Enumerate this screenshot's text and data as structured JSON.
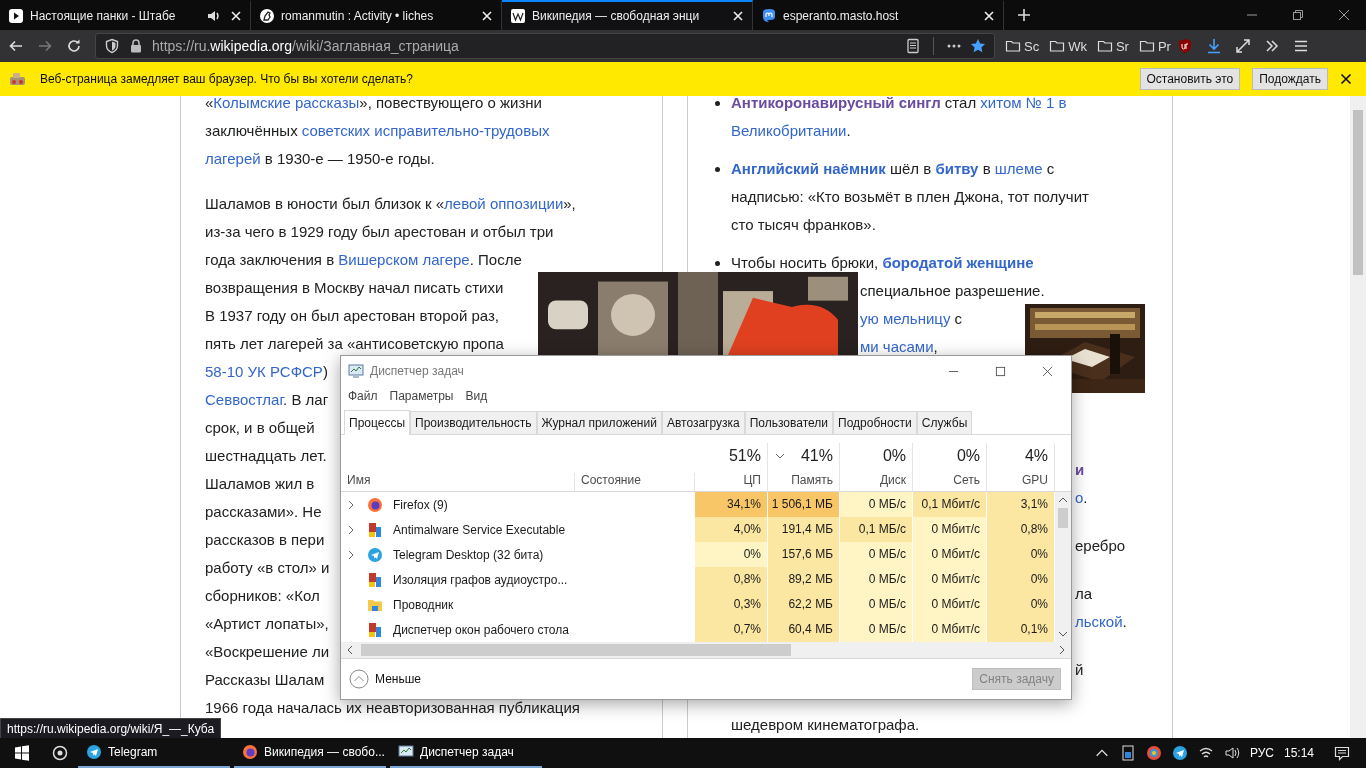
{
  "browser": {
    "tabs": [
      {
        "title": "Настоящие панки - Штабе",
        "kind": "video",
        "audio": true,
        "selected": false
      },
      {
        "title": "romanmutin : Activity • liches",
        "kind": "chess",
        "audio": false,
        "selected": false
      },
      {
        "title": "Википедия — свободная энци",
        "kind": "wiki",
        "audio": false,
        "selected": true
      },
      {
        "title": "esperanto.masto.host",
        "kind": "mastodon",
        "audio": false,
        "selected": false
      }
    ],
    "url": {
      "scheme": "https://ru.",
      "domain": "wikipedia.org",
      "path": "/wiki/Заглавная_страница"
    },
    "bookmarks": [
      "Sc",
      "Wk",
      "Sr",
      "Pr"
    ],
    "notification": {
      "text": "Веб-страница замедляет ваш браузер. Что бы вы хотели сделать?",
      "buttons": [
        "Остановить это",
        "Подождать"
      ]
    }
  },
  "article": {
    "left_paragraphs": [
      [
        [
          {
            "text": "«",
            "kind": "plain"
          },
          {
            "text": "Колымские рассказы",
            "kind": "link"
          },
          {
            "text": "», повествующего о жизни",
            "kind": "plain"
          }
        ],
        [
          {
            "text": "заключённых ",
            "kind": "plain"
          },
          {
            "text": "советских исправительно-трудовых",
            "kind": "link"
          }
        ],
        [
          {
            "text": "лагерей",
            "kind": "link"
          },
          {
            "text": " в 1930-е — 1950-е годы.",
            "kind": "plain"
          }
        ]
      ],
      [
        [
          {
            "text": "Шаламов в юности был близок к «",
            "kind": "plain"
          },
          {
            "text": "левой оппозиции",
            "kind": "link"
          },
          {
            "text": "»,",
            "kind": "plain"
          }
        ],
        [
          {
            "text": "из-за чего в 1929 году был арестован и отбыл три",
            "kind": "plain"
          }
        ],
        [
          {
            "text": "года заключения в ",
            "kind": "plain"
          },
          {
            "text": "Вишерском лагере",
            "kind": "link"
          },
          {
            "text": ". После",
            "kind": "plain"
          }
        ],
        [
          {
            "text": "возвращения в Москву начал писать стихи",
            "kind": "plain"
          }
        ],
        [
          {
            "text": "В 1937 году он был арестован второй раз,",
            "kind": "plain"
          }
        ],
        [
          {
            "text": "пять лет лагерей за «антисоветскую пропа",
            "kind": "plain"
          }
        ],
        [
          {
            "text": "58-10 УК РСФСР",
            "kind": "link"
          },
          {
            "text": ")",
            "kind": "plain"
          }
        ],
        [
          {
            "text": "Севвостлаг",
            "kind": "link"
          },
          {
            "text": ". В лаг",
            "kind": "plain"
          }
        ],
        [
          {
            "text": "срок, и в общей",
            "kind": "plain"
          }
        ],
        [
          {
            "text": "шестнадцать лет.",
            "kind": "plain"
          }
        ],
        [
          {
            "text": "Шаламов жил в",
            "kind": "plain"
          }
        ],
        [
          {
            "text": "рассказами». Не",
            "kind": "plain"
          }
        ],
        [
          {
            "text": "рассказов в пери",
            "kind": "plain"
          }
        ],
        [
          {
            "text": "работу «в стол» и",
            "kind": "plain"
          }
        ],
        [
          {
            "text": "сборников: «Кол",
            "kind": "plain"
          }
        ],
        [
          {
            "text": "«Артист лопаты»,",
            "kind": "plain"
          }
        ],
        [
          {
            "text": "«Воскрешение ли",
            "kind": "plain"
          }
        ],
        [
          {
            "text": "Рассказы Шалам",
            "kind": "plain"
          }
        ],
        [
          {
            "text": "1966 года началась их неавторизованная публикация",
            "kind": "plain"
          }
        ]
      ]
    ],
    "right_items": [
      {
        "lines": [
          [
            {
              "text": "Антикоронавирусный сингл",
              "kind": "visited-bold"
            },
            {
              "text": " стал ",
              "kind": "plain"
            },
            {
              "text": "хитом № 1 в",
              "kind": "link"
            }
          ],
          [
            {
              "text": "Великобритании",
              "kind": "link"
            },
            {
              "text": ".",
              "kind": "plain"
            }
          ]
        ]
      },
      {
        "lines": [
          [
            {
              "text": "Английский наёмник",
              "kind": "bold-link"
            },
            {
              "text": " шёл в ",
              "kind": "plain"
            },
            {
              "text": "битву",
              "kind": "bold-link"
            },
            {
              "text": " в ",
              "kind": "plain"
            },
            {
              "text": "шлеме",
              "kind": "link"
            },
            {
              "text": " с",
              "kind": "plain"
            }
          ],
          [
            {
              "text": "надписью: «Кто возьмёт в плен Джона, тот получит",
              "kind": "plain"
            }
          ],
          [
            {
              "text": "сто тысяч франков».",
              "kind": "plain"
            }
          ]
        ]
      },
      {
        "lines": [
          [
            {
              "text": "Чтобы носить брюки, ",
              "kind": "plain"
            },
            {
              "text": "бородатой женщине",
              "kind": "bold-link"
            }
          ]
        ],
        "after_picture": [
          [
            {
              "text": "специальное разрешение.",
              "kind": "plain"
            }
          ],
          [
            {
              "text": "ую мельницу",
              "kind": "link"
            },
            {
              "text": " с",
              "kind": "plain"
            }
          ],
          [
            {
              "text": "ми часами",
              "kind": "link"
            },
            {
              "text": ",",
              "kind": "plain"
            }
          ]
        ]
      }
    ],
    "right_fragments": [
      [
        [
          {
            "text": "и",
            "kind": "visited-bold"
          }
        ],
        [
          {
            "text": "о",
            "kind": "link"
          },
          {
            "text": ".",
            "kind": "plain"
          }
        ]
      ],
      [
        [
          {
            "text": "еребро",
            "kind": "plain"
          }
        ]
      ],
      [
        [
          {
            "text": "ла",
            "kind": "plain"
          }
        ],
        [
          {
            "text": "льской",
            "kind": "link"
          },
          {
            "text": ".",
            "kind": "plain"
          }
        ]
      ],
      [
        [
          {
            "text": "й",
            "kind": "plain"
          }
        ]
      ]
    ],
    "right_last_line": "шедевром кинематографа."
  },
  "status_url": "https://ru.wikipedia.org/wiki/Я_—_Куба",
  "task_manager": {
    "title": "Диспетчер задач",
    "menu": [
      "Файл",
      "Параметры",
      "Вид"
    ],
    "tabs": [
      {
        "label": "Процессы",
        "selected": true
      },
      {
        "label": "Производительность",
        "selected": false
      },
      {
        "label": "Журнал приложений",
        "selected": false
      },
      {
        "label": "Автозагрузка",
        "selected": false
      },
      {
        "label": "Пользователи",
        "selected": false
      },
      {
        "label": "Подробности",
        "selected": false
      },
      {
        "label": "Службы",
        "selected": false
      }
    ],
    "name_column": "Имя",
    "status_column": "Состояние",
    "columns": [
      {
        "percent": "51%",
        "label": "ЦП",
        "sorted": false
      },
      {
        "percent": "41%",
        "label": "Память",
        "sorted": true
      },
      {
        "percent": "0%",
        "label": "Диск",
        "sorted": false
      },
      {
        "percent": "0%",
        "label": "Сеть",
        "sorted": false
      },
      {
        "percent": "4%",
        "label": "GPU",
        "sorted": false
      }
    ],
    "rows": [
      {
        "name": "Firefox (9)",
        "kind": "browser",
        "expandable": true,
        "cells": [
          {
            "text": "34,1%",
            "color": "#f8c666"
          },
          {
            "text": "1 506,1 МБ",
            "color": "#f8c666"
          },
          {
            "text": "0 МБ/с",
            "color": "#fff4c4"
          },
          {
            "text": "0,1 Мбит/с",
            "color": "#fbe6a2"
          },
          {
            "text": "3,1%",
            "color": "#fbe6a2"
          }
        ]
      },
      {
        "name": "Antimalware Service Executable",
        "kind": "service",
        "expandable": true,
        "cells": [
          {
            "text": "4,0%",
            "color": "#fbe6a2"
          },
          {
            "text": "191,4 МБ",
            "color": "#fbe6a2"
          },
          {
            "text": "0,1 МБ/с",
            "color": "#fbe6a2"
          },
          {
            "text": "0 Мбит/с",
            "color": "#fff4c4"
          },
          {
            "text": "0,8%",
            "color": "#fbe6a2"
          }
        ]
      },
      {
        "name": "Telegram Desktop (32 бита)",
        "kind": "messenger",
        "expandable": true,
        "cells": [
          {
            "text": "0%",
            "color": "#fff4c4"
          },
          {
            "text": "157,6 МБ",
            "color": "#fbe6a2"
          },
          {
            "text": "0 МБ/с",
            "color": "#fff4c4"
          },
          {
            "text": "0 Мбит/с",
            "color": "#fff4c4"
          },
          {
            "text": "0%",
            "color": "#fbe6a2"
          }
        ]
      },
      {
        "name": "Изоляция графов аудиоустро...",
        "kind": "service",
        "expandable": false,
        "cells": [
          {
            "text": "0,8%",
            "color": "#fbe6a2"
          },
          {
            "text": "89,2 МБ",
            "color": "#fbe6a2"
          },
          {
            "text": "0 МБ/с",
            "color": "#fff4c4"
          },
          {
            "text": "0 Мбит/с",
            "color": "#fff4c4"
          },
          {
            "text": "0%",
            "color": "#fbe6a2"
          }
        ]
      },
      {
        "name": "Проводник",
        "kind": "folder",
        "expandable": false,
        "cells": [
          {
            "text": "0,3%",
            "color": "#fbe6a2"
          },
          {
            "text": "62,2 МБ",
            "color": "#fbe6a2"
          },
          {
            "text": "0 МБ/с",
            "color": "#fff4c4"
          },
          {
            "text": "0 Мбит/с",
            "color": "#fff4c4"
          },
          {
            "text": "0%",
            "color": "#fbe6a2"
          }
        ]
      },
      {
        "name": "Диспетчер окон рабочего стола",
        "kind": "service",
        "expandable": false,
        "cells": [
          {
            "text": "0,7%",
            "color": "#fbe6a2"
          },
          {
            "text": "60,4 МБ",
            "color": "#fbe6a2"
          },
          {
            "text": "0 МБ/с",
            "color": "#fff4c4"
          },
          {
            "text": "0 Мбит/с",
            "color": "#fff4c4"
          },
          {
            "text": "0,1%",
            "color": "#fbe6a2"
          }
        ]
      }
    ],
    "toggle": "Меньше",
    "end_task": {
      "label": "Снять задачу",
      "disabled": true
    }
  },
  "taskbar": {
    "items": [
      {
        "label": "Telegram",
        "kind": "messenger"
      },
      {
        "label": "Википедия — свобо...",
        "kind": "browser"
      },
      {
        "label": "Диспетчер задач",
        "kind": "monitor"
      }
    ],
    "language": "РУС",
    "time": "15:14"
  }
}
